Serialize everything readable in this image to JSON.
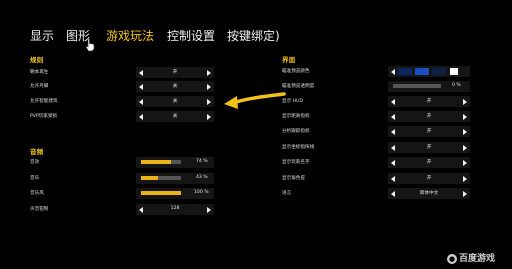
{
  "nav": {
    "tabs": [
      {
        "label": "显示",
        "active": false
      },
      {
        "label": "图形",
        "active": false
      },
      {
        "label": "游戏玩法",
        "active": true
      },
      {
        "label": "控制设置",
        "active": false
      },
      {
        "label": "按键绑定)",
        "active": false
      }
    ]
  },
  "rules": {
    "title": "规则",
    "rows": [
      {
        "label": "朝本再生",
        "value": "开"
      },
      {
        "label": "允许丹脚",
        "value": "关"
      },
      {
        "label": "允许智能建筑",
        "value": "关"
      },
      {
        "label": "PVP玩家受损",
        "value": "关"
      }
    ]
  },
  "audio": {
    "title": "音频",
    "rows": [
      {
        "label": "音效",
        "value": "74 %",
        "level": 0.74
      },
      {
        "label": "音乐",
        "value": "43 %",
        "level": 0.43
      },
      {
        "label": "音乐风",
        "value": "100 %",
        "level": 1.0
      },
      {
        "label": "声音钳制",
        "value": "128"
      }
    ]
  },
  "interface": {
    "title": "界面",
    "rows": [
      {
        "label": "瞄准预览颜色",
        "type": "color"
      },
      {
        "label": "瞄准预览透明度",
        "type": "slider",
        "value": "0 %",
        "level": 0.0
      },
      {
        "label": "显示 HUD",
        "type": "select",
        "value": "开"
      },
      {
        "label": "显示距离指标",
        "type": "select",
        "value": "开"
      },
      {
        "label": "分析跟踪指标",
        "type": "select",
        "value": "开"
      },
      {
        "label": "显示坐标指挥线",
        "type": "select",
        "value": "开"
      },
      {
        "label": "显示玩家名字",
        "type": "select",
        "value": "开"
      },
      {
        "label": "显示角色提",
        "type": "select",
        "value": "开"
      },
      {
        "label": "语言",
        "type": "select",
        "value": "简体中文"
      }
    ]
  },
  "colors": {
    "accent": "#f2c318",
    "swatch_dark": "#0b2660",
    "swatch_blue": "#1a4cc2",
    "swatch_light": "#ffffff"
  },
  "watermark": {
    "text": "百度游戏",
    "icon": "baidu-paw-icon"
  }
}
